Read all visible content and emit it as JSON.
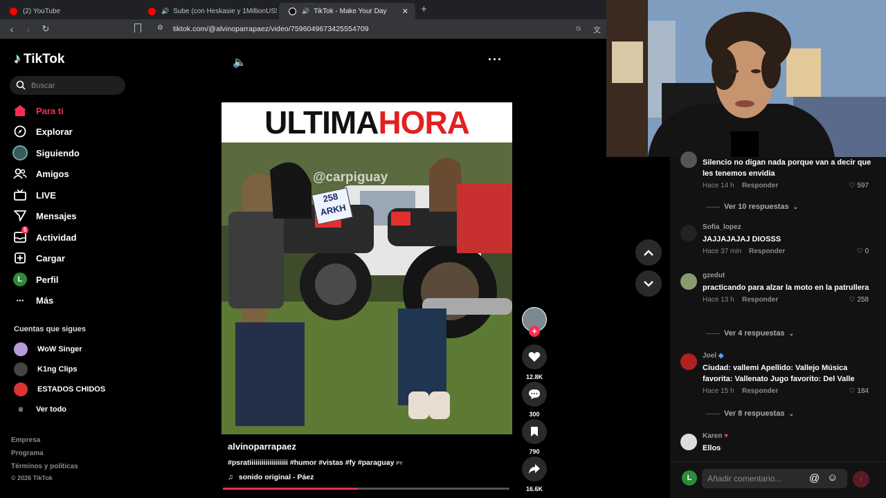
{
  "browser": {
    "tabs": [
      {
        "title": "(2) YouTube",
        "icon": "youtube-icon",
        "color": "#ff0000"
      },
      {
        "title": "Sube (con Heskasie y 1MillionUS$",
        "icon": "youtube-icon",
        "color": "#ff0000"
      },
      {
        "title": "TikTok - Make Your Day",
        "icon": "tiktok-icon",
        "color": "#ffffff"
      }
    ],
    "url": "tiktok.com/@alvinoparrapaez/video/7596049673425554709"
  },
  "sidebar": {
    "logo": "TikTok",
    "search_placeholder": "Buscar",
    "nav": [
      {
        "label": "Para ti",
        "icon": "home-icon",
        "active": true
      },
      {
        "label": "Explorar",
        "icon": "compass-icon"
      },
      {
        "label": "Siguiendo",
        "icon": "following-avatar-icon"
      },
      {
        "label": "Amigos",
        "icon": "friends-icon"
      },
      {
        "label": "LIVE",
        "icon": "live-tv-icon"
      },
      {
        "label": "Mensajes",
        "icon": "send-icon"
      },
      {
        "label": "Actividad",
        "icon": "inbox-icon",
        "badge": "5"
      },
      {
        "label": "Cargar",
        "icon": "upload-plus-icon"
      },
      {
        "label": "Perfil",
        "icon": "profile-avatar-icon",
        "avatar_letter": "L"
      },
      {
        "label": "Más",
        "icon": "more-dots-icon"
      }
    ],
    "following_header": "Cuentas que sigues",
    "following": [
      {
        "name": "WoW Singer"
      },
      {
        "name": "K1ng Clips"
      },
      {
        "name": "ESTADOS CHIDOS"
      }
    ],
    "see_all": "Ver todo",
    "footer": [
      "Empresa",
      "Programa",
      "Términos y políticas",
      "© 2026 TikTok"
    ]
  },
  "video": {
    "title_part1": "ULTIMA",
    "title_part2": "HORA",
    "watermark": "@carpiguay",
    "plate": "258\nARKH",
    "author": "alvinoparrapaez",
    "caption": "#psratiiiiiiiiiiiiiiiiiii #humor #vistas #fy #paraguay",
    "caption_suffix": "PY",
    "sound": "sonido original - Páez",
    "progress": 0.47,
    "colors": {
      "accent": "#fe2c55",
      "red_title": "#e41f1f"
    }
  },
  "actions": [
    {
      "icon": "heart-icon",
      "count": "12.8K"
    },
    {
      "icon": "comment-icon",
      "count": "300"
    },
    {
      "icon": "bookmark-icon",
      "count": "790"
    },
    {
      "icon": "share-icon",
      "count": "16.6K"
    }
  ],
  "comments": [
    {
      "name": "",
      "text": "Silencio no digan nada porque van a decir que les tenemos envidia",
      "time": "Hace 14 h",
      "reply": "Responder",
      "likes": "597",
      "replies": "Ver 10 respuestas"
    },
    {
      "name": "Sofia_lopez",
      "text": "JAJJAJAJAJ DIOSSS",
      "time": "Hace 37 min",
      "reply": "Responder",
      "likes": "0"
    },
    {
      "name": "gzedut",
      "text": "practicando para alzar la moto en la patrullera",
      "time": "Hace 13 h",
      "reply": "Responder",
      "likes": "258",
      "replies": "Ver 4 respuestas"
    },
    {
      "name": "Joel",
      "text": "Ciudad: vallemi Apellido: Vallejo Música favorita: Vallenato Jugo favorito: Del Valle",
      "time": "Hace 15 h",
      "reply": "Responder",
      "likes": "184",
      "replies": "Ver 8 respuestas"
    },
    {
      "name": "Karen",
      "text": "Ellos"
    }
  ],
  "comment_input": {
    "placeholder": "Añadir comentario...",
    "avatar_letter": "L"
  }
}
